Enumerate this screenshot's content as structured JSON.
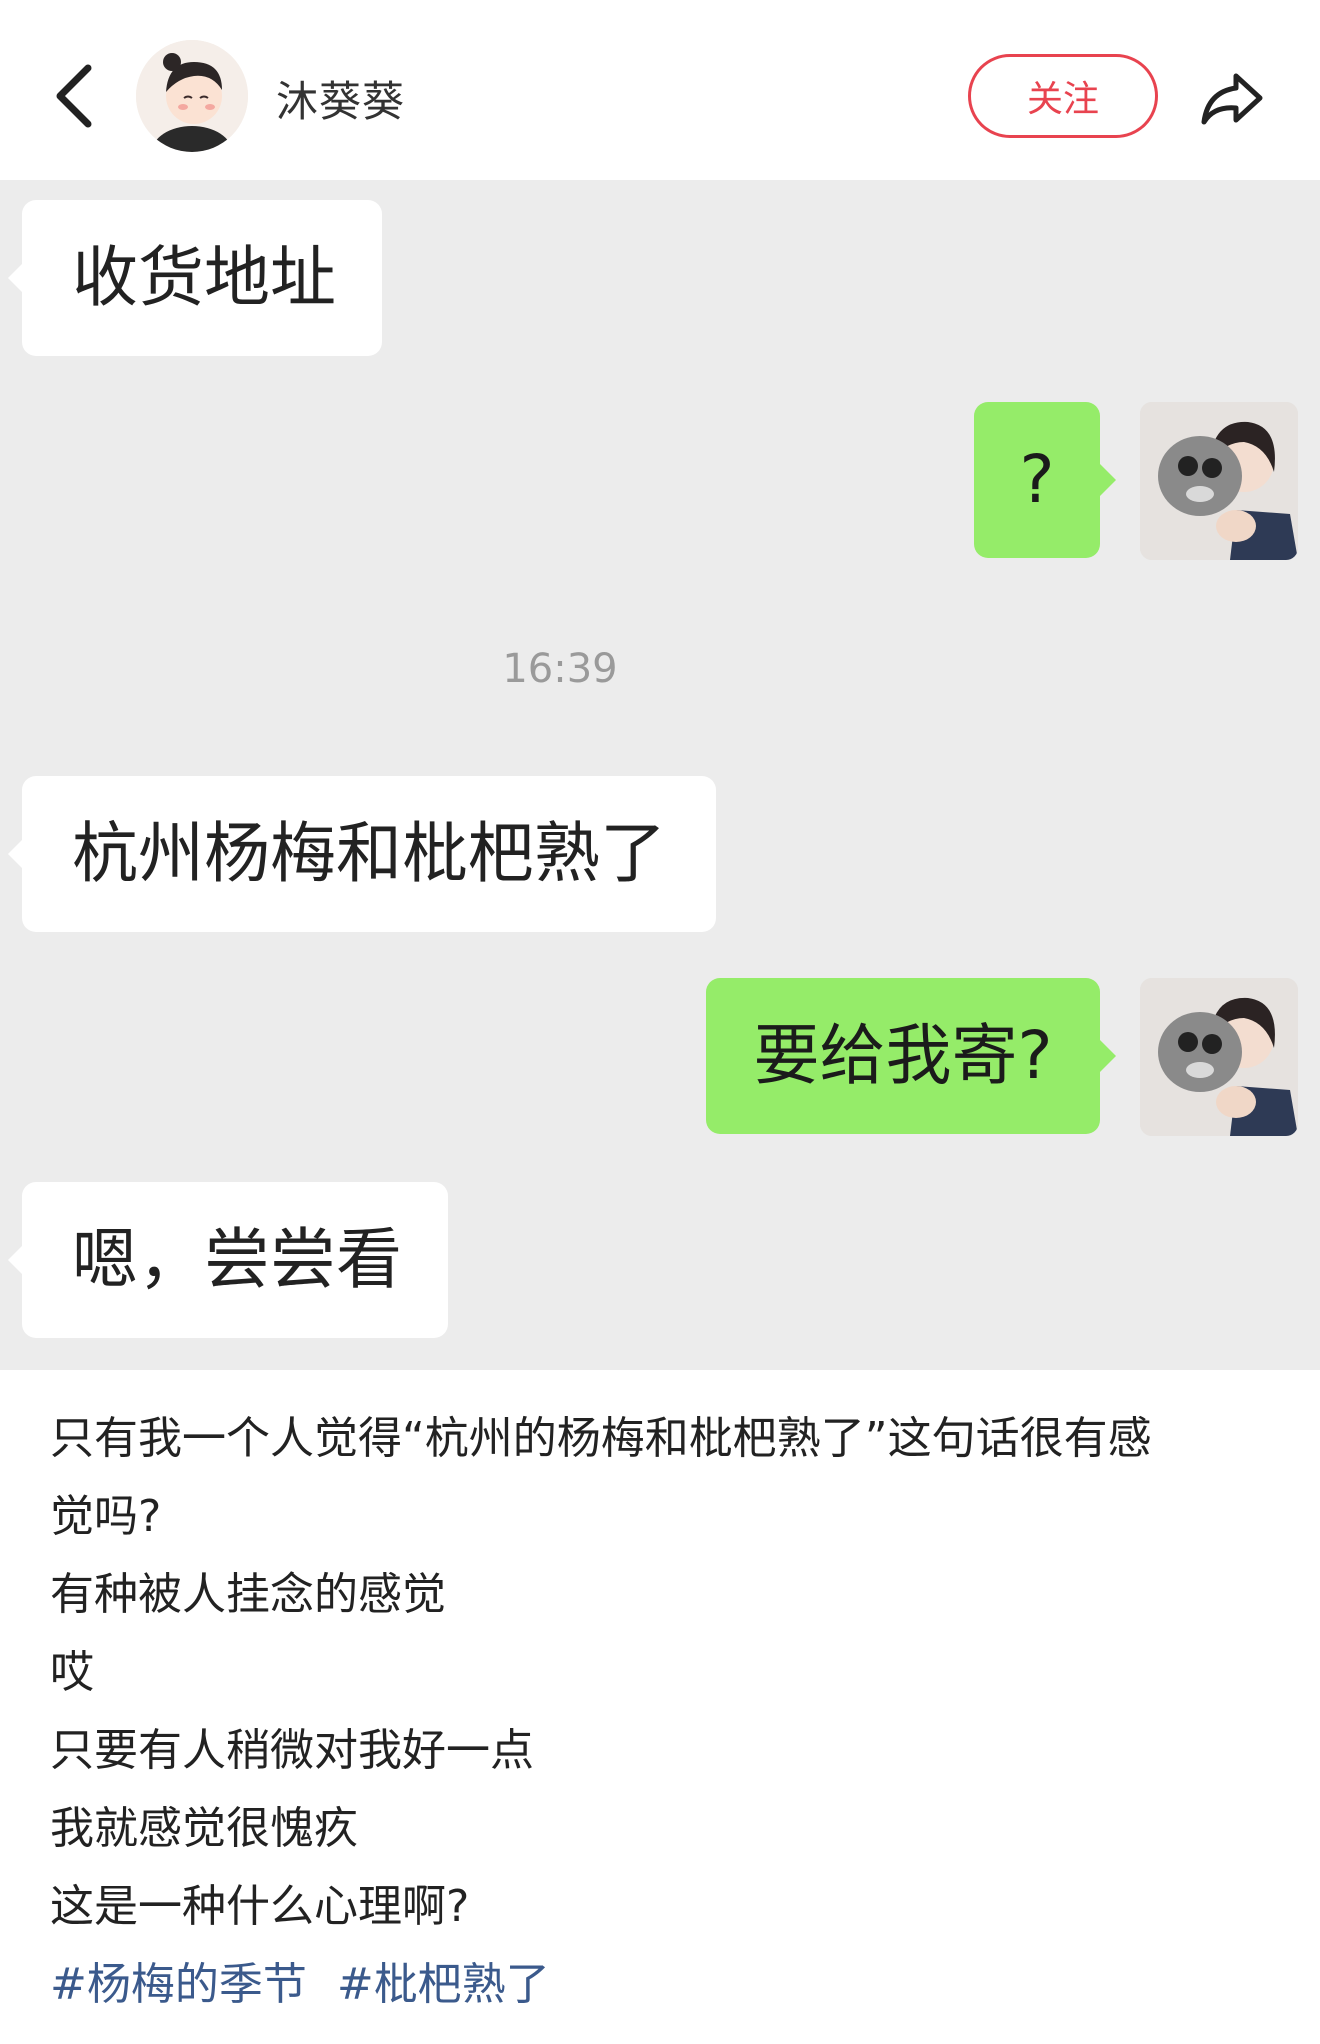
{
  "header": {
    "author_name": "沐葵葵",
    "follow_label": "关注",
    "back_icon": "chevron-left-icon",
    "share_icon": "share-arrow-icon"
  },
  "chat": {
    "messages": [
      {
        "side": "received",
        "text": "收货地址"
      },
      {
        "side": "sent",
        "text": "?"
      },
      {
        "side": "received",
        "text": "杭州杨梅和枇杷熟了"
      },
      {
        "side": "sent",
        "text": "要给我寄?"
      },
      {
        "side": "received",
        "text": "嗯，尝尝看"
      }
    ],
    "timestamp": "16:39",
    "colors": {
      "background": "#ececec",
      "sent_bubble": "#95ec69",
      "received_bubble": "#ffffff"
    }
  },
  "post": {
    "lines": [
      "只有我一个人觉得“杭州的杨梅和枇杷熟了”这句话很有感",
      "觉吗?",
      "有种被人挂念的感觉",
      "哎",
      "只要有人稍微对我好一点",
      "我就感觉很愧疚",
      "这是一种什么心理啊?"
    ],
    "tags": [
      "#杨梅的季节",
      "#枇杷熟了"
    ]
  },
  "colors": {
    "accent": "#e8434f",
    "tag": "#3b5a8c"
  }
}
